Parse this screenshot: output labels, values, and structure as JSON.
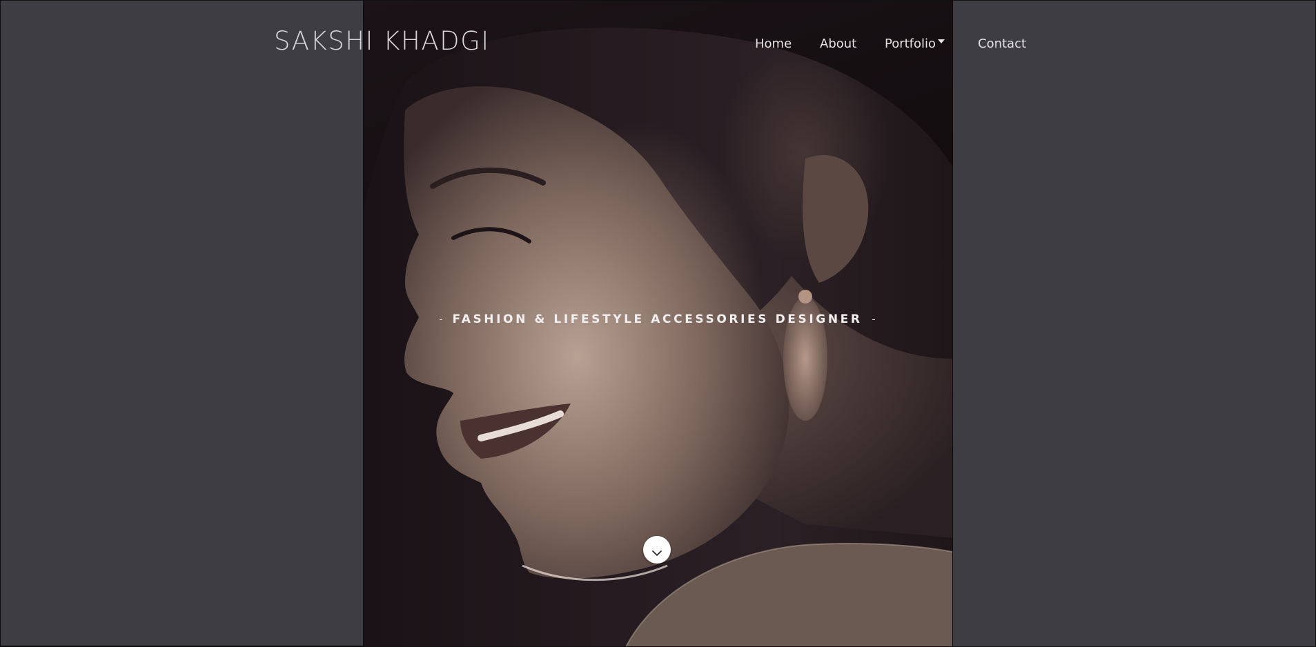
{
  "header": {
    "brand": "SAKSHI KHADGI",
    "nav": {
      "home": "Home",
      "about": "About",
      "portfolio": "Portfolio",
      "contact": "Contact"
    }
  },
  "hero": {
    "tagline": "FASHION & LIFESTYLE ACCESSORIES DESIGNER",
    "image": "portrait-photo",
    "scroll_icon": "chevron-down-icon"
  },
  "colors": {
    "page_background": "#3f3d44",
    "text_light": "#e6e2e4",
    "scroll_button": "#ffffff"
  }
}
